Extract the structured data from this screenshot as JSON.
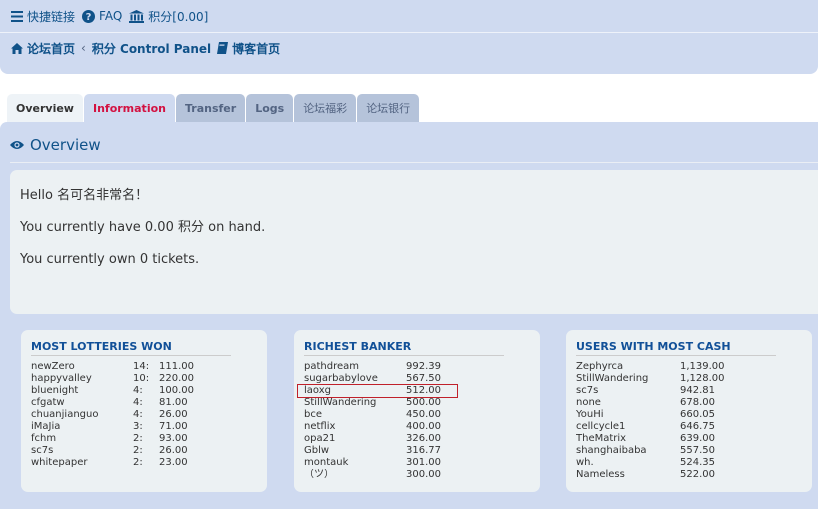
{
  "topbar": {
    "quicklinks_label": "快捷链接",
    "faq_label": "FAQ",
    "points_label": "积分[0.00]"
  },
  "breadcrumb": {
    "forum_home": "论坛首页",
    "control_panel": "积分 Control Panel",
    "blog_home": "博客首页"
  },
  "tabs": [
    {
      "label": "Overview"
    },
    {
      "label": "Information"
    },
    {
      "label": "Transfer"
    },
    {
      "label": "Logs"
    },
    {
      "label": "论坛福彩"
    },
    {
      "label": "论坛银行"
    }
  ],
  "panel": {
    "title": "Overview",
    "greeting": "Hello 名可名非常名！",
    "points_line": "You currently have 0.00 积分 on hand.",
    "tickets_line": "You currently own 0 tickets."
  },
  "lotteries": {
    "title": "MOST LOTTERIES WON",
    "rows": [
      {
        "name": "newZero",
        "count": "14:",
        "amount": "111.00"
      },
      {
        "name": "happyvalley",
        "count": "10:",
        "amount": "220.00"
      },
      {
        "name": "bluenight",
        "count": "4:",
        "amount": "100.00"
      },
      {
        "name": "cfgatw",
        "count": "4:",
        "amount": "81.00"
      },
      {
        "name": "chuanjianguo",
        "count": "4:",
        "amount": "26.00"
      },
      {
        "name": "iMaJia",
        "count": "3:",
        "amount": "71.00"
      },
      {
        "name": "fchm",
        "count": "2:",
        "amount": "93.00"
      },
      {
        "name": "sc7s",
        "count": "2:",
        "amount": "26.00"
      },
      {
        "name": "whitepaper",
        "count": "2:",
        "amount": "23.00"
      }
    ]
  },
  "banker": {
    "title": "RICHEST BANKER",
    "rows": [
      {
        "name": "pathdream",
        "amount": "992.39"
      },
      {
        "name": "sugarbabylove",
        "amount": "567.50"
      },
      {
        "name": "laoxg",
        "amount": "512.00"
      },
      {
        "name": "StillWandering",
        "amount": "500.00"
      },
      {
        "name": "bce",
        "amount": "450.00"
      },
      {
        "name": "netflix",
        "amount": "400.00"
      },
      {
        "name": "opa21",
        "amount": "326.00"
      },
      {
        "name": "Gblw",
        "amount": "316.77"
      },
      {
        "name": "montauk",
        "amount": "301.00"
      },
      {
        "name": "（ツ）",
        "amount": "300.00"
      }
    ]
  },
  "cash": {
    "title": "USERS WITH MOST CASH",
    "rows": [
      {
        "name": "Zephyrca",
        "amount": "1,139.00"
      },
      {
        "name": "StillWandering",
        "amount": "1,128.00"
      },
      {
        "name": "sc7s",
        "amount": "942.81"
      },
      {
        "name": "none",
        "amount": "678.00"
      },
      {
        "name": "YouHi",
        "amount": "660.05"
      },
      {
        "name": "cellcycle1",
        "amount": "646.75"
      },
      {
        "name": "TheMatrix",
        "amount": "639.00"
      },
      {
        "name": "shanghaibaba",
        "amount": "557.50"
      },
      {
        "name": "wh.",
        "amount": "524.35"
      },
      {
        "name": "Nameless",
        "amount": "522.00"
      }
    ]
  },
  "icons": {
    "menu": "bars-icon",
    "faq": "question-circle-icon",
    "points": "bank-icon",
    "home": "home-icon",
    "chevron": "chevron-left-icon",
    "blog": "book-icon",
    "overview": "eye-icon"
  },
  "colors": {
    "link": "#105289",
    "header_bg": "#cfdaf0",
    "tab_highlight": "#d31141",
    "marker": "#c0202a"
  }
}
